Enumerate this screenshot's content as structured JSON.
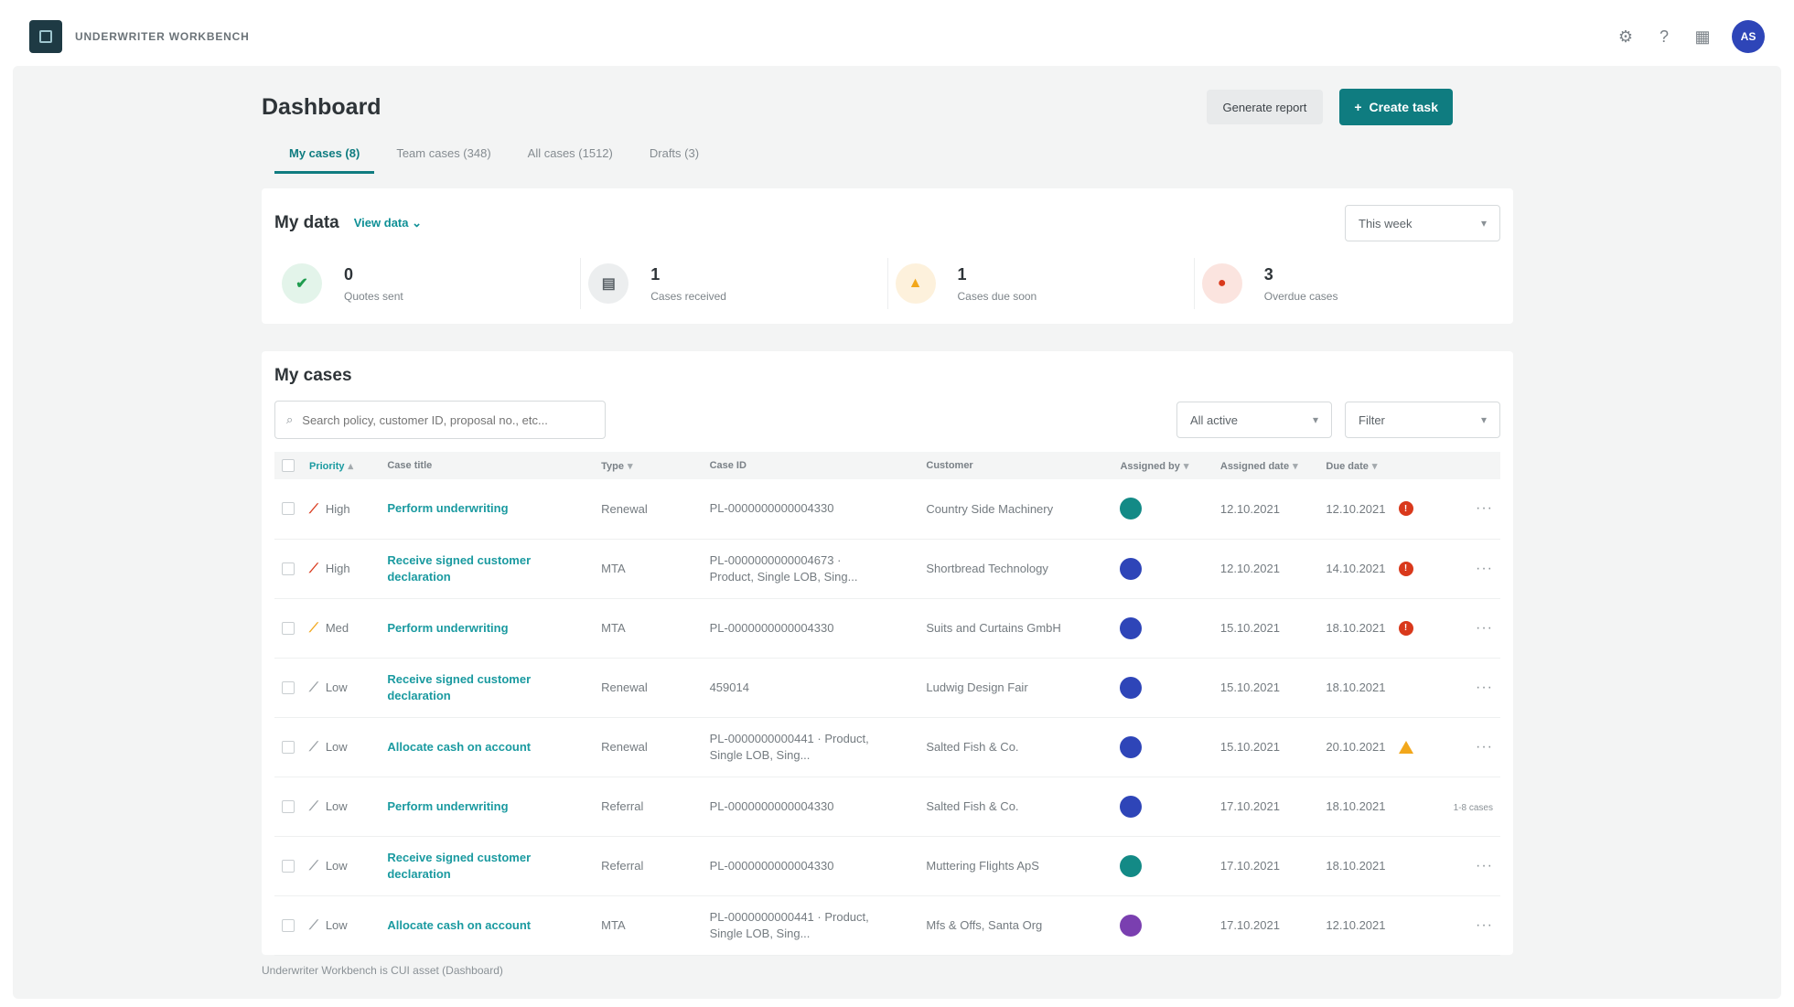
{
  "app": {
    "name": "UNDERWRITER WORKBENCH",
    "avatar_initials": "AS",
    "top_icons": [
      "settings-icon",
      "help-icon",
      "apps-icon"
    ]
  },
  "header": {
    "title": "Dashboard",
    "generate_report_label": "Generate report",
    "create_task_label": "Create task"
  },
  "tabs": [
    {
      "label": "My cases (8)",
      "active": true
    },
    {
      "label": "Team cases (348)",
      "active": false
    },
    {
      "label": "All cases (1512)",
      "active": false
    },
    {
      "label": "Drafts (3)",
      "active": false
    }
  ],
  "my_data": {
    "title": "My data",
    "view_link": "View data",
    "period": "This week",
    "stats": [
      {
        "value": "0",
        "label": "Quotes sent",
        "color": "#1f9c4f",
        "bg": "#e3f4ea",
        "icon": "check-icon"
      },
      {
        "value": "1",
        "label": "Cases received",
        "color": "#5c6368",
        "bg": "#eceeef",
        "icon": "inbox-icon"
      },
      {
        "value": "1",
        "label": "Cases due soon",
        "color": "#f2a71b",
        "bg": "#fdf1dc",
        "icon": "warning-icon"
      },
      {
        "value": "3",
        "label": "Overdue cases",
        "color": "#d9391c",
        "bg": "#fbe4df",
        "icon": "alert-icon"
      }
    ]
  },
  "my_cases": {
    "title": "My cases",
    "search_placeholder": "Search policy, customer ID, proposal no., etc...",
    "status_filter": "All active",
    "filter_label": "Filter",
    "columns": [
      "Priority",
      "Case title",
      "Type",
      "Case ID",
      "Customer",
      "Assigned by",
      "Assigned date",
      "Due date"
    ],
    "rows": [
      {
        "priority": "High",
        "prio_color": "#d9391c",
        "title": "Perform underwriting",
        "type": "Renewal",
        "id": "PL-0000000000004330",
        "customer": "Country Side Machinery",
        "assignee_color": "#138a86",
        "assigned": "12.10.2021",
        "due": "12.10.2021",
        "due_flag": "overdue"
      },
      {
        "priority": "High",
        "prio_color": "#d9391c",
        "title": "Receive signed customer declaration",
        "type": "MTA",
        "id": "PL-0000000000004673 · Product, Single LOB, Sing...",
        "customer": "Shortbread Technology",
        "assignee_color": "#2e45b8",
        "assigned": "12.10.2021",
        "due": "14.10.2021",
        "due_flag": "overdue"
      },
      {
        "priority": "Med",
        "prio_color": "#f2a71b",
        "title": "Perform underwriting",
        "type": "MTA",
        "id": "PL-0000000000004330",
        "customer": "Suits and Curtains GmbH",
        "assignee_color": "#2e45b8",
        "assigned": "15.10.2021",
        "due": "18.10.2021",
        "due_flag": "overdue"
      },
      {
        "priority": "Low",
        "prio_color": "#9aa0a5",
        "title": "Receive signed customer declaration",
        "type": "Renewal",
        "id": "459014",
        "customer": "Ludwig Design Fair",
        "assignee_color": "#2e45b8",
        "assigned": "15.10.2021",
        "due": "18.10.2021",
        "due_flag": ""
      },
      {
        "priority": "Low",
        "prio_color": "#9aa0a5",
        "title": "Allocate cash on account",
        "type": "Renewal",
        "id": "PL-0000000000441 · Product, Single LOB, Sing...",
        "customer": "Salted Fish & Co.",
        "assignee_color": "#2e45b8",
        "assigned": "15.10.2021",
        "due": "20.10.2021",
        "due_flag": "soon"
      },
      {
        "priority": "Low",
        "prio_color": "#9aa0a5",
        "title": "Perform underwriting",
        "type": "Referral",
        "id": "PL-0000000000004330",
        "customer": "Salted Fish & Co.",
        "assignee_color": "#2e45b8",
        "assigned": "17.10.2021",
        "due": "18.10.2021",
        "due_flag": "",
        "pager": "1-8 cases"
      },
      {
        "priority": "Low",
        "prio_color": "#9aa0a5",
        "title": "Receive signed customer declaration",
        "type": "Referral",
        "id": "PL-0000000000004330",
        "customer": "Muttering Flights ApS",
        "assignee_color": "#138a86",
        "assigned": "17.10.2021",
        "due": "18.10.2021",
        "due_flag": ""
      },
      {
        "priority": "Low",
        "prio_color": "#9aa0a5",
        "title": "Allocate cash on account",
        "type": "MTA",
        "id": "PL-0000000000441 · Product, Single LOB, Sing...",
        "customer": "Mfs & Offs, Santa Org",
        "assignee_color": "#7a3fb0",
        "assigned": "17.10.2021",
        "due": "12.10.2021",
        "due_flag": ""
      }
    ]
  },
  "footer": "Underwriter Workbench is CUI asset (Dashboard)"
}
